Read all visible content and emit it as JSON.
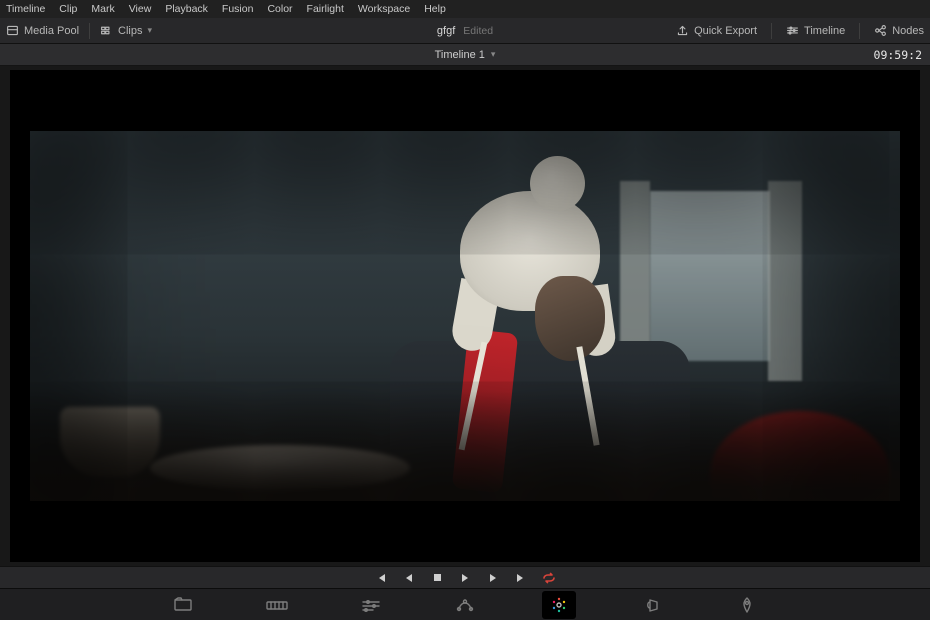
{
  "menu": {
    "items": [
      "Timeline",
      "Clip",
      "Mark",
      "View",
      "Playback",
      "Fusion",
      "Color",
      "Fairlight",
      "Workspace",
      "Help"
    ]
  },
  "topbar": {
    "media_pool": "Media Pool",
    "clips": "Clips",
    "project_title": "gfgf",
    "project_status": "Edited",
    "quick_export": "Quick Export",
    "timeline": "Timeline",
    "nodes": "Nodes"
  },
  "timeline_strip": {
    "name": "Timeline 1",
    "timecode": "09:59:2"
  },
  "transport": {
    "icons": [
      "first-frame",
      "prev-frame",
      "stop",
      "play",
      "next-frame",
      "last-frame",
      "loop"
    ]
  },
  "page_tabs": {
    "tabs": [
      "media",
      "cut",
      "edit",
      "fusion",
      "color",
      "fairlight",
      "deliver"
    ],
    "active": "color"
  },
  "colors": {
    "accent_loop": "#d9443a",
    "bg_dark": "#1b1b1b",
    "panel": "#28282a"
  }
}
